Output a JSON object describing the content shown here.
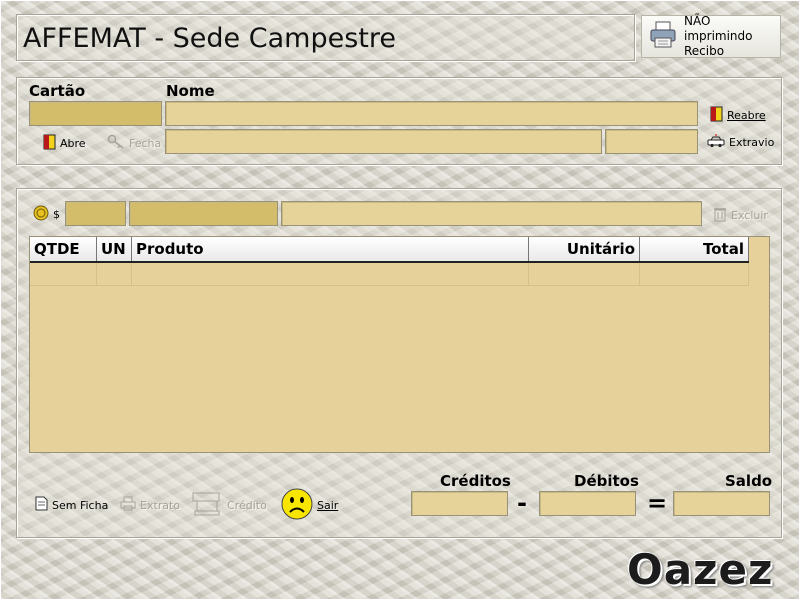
{
  "window": {
    "title": "AFFEMAT - Sede Campestre"
  },
  "print_toggle": {
    "line1": "NÃO imprimindo",
    "line2": "Recibo",
    "icon": "printer-icon"
  },
  "card_section": {
    "cartao_label": "Cartão",
    "nome_label": "Nome",
    "cartao_value": "",
    "nome_value": "",
    "reabre_label": "Reabre",
    "extravio_label": "Extravio",
    "abre_label": "Abre",
    "fecha_label": "Fecha"
  },
  "item_section": {
    "currency_symbol": "$",
    "excluir_label": "Excluir"
  },
  "table": {
    "columns": [
      "QTDE",
      "UN",
      "Produto",
      "Unitário",
      "Total"
    ],
    "rows": []
  },
  "footer": {
    "sem_ficha_label": "Sem Ficha",
    "extrato_label": "Extrato",
    "credito_label": "Crédito",
    "sair_label": "Sair",
    "creditos_label": "Créditos",
    "debitos_label": "Débitos",
    "saldo_label": "Saldo",
    "minus_sign": "-",
    "equals_sign": "=",
    "creditos_value": "",
    "debitos_value": "",
    "saldo_value": ""
  },
  "brand": {
    "logo_text": "Oazez"
  },
  "colors": {
    "field_bg": "#e5d39a",
    "field_dark": "#d4bd6a",
    "grid_bg": "#e6d19b"
  }
}
